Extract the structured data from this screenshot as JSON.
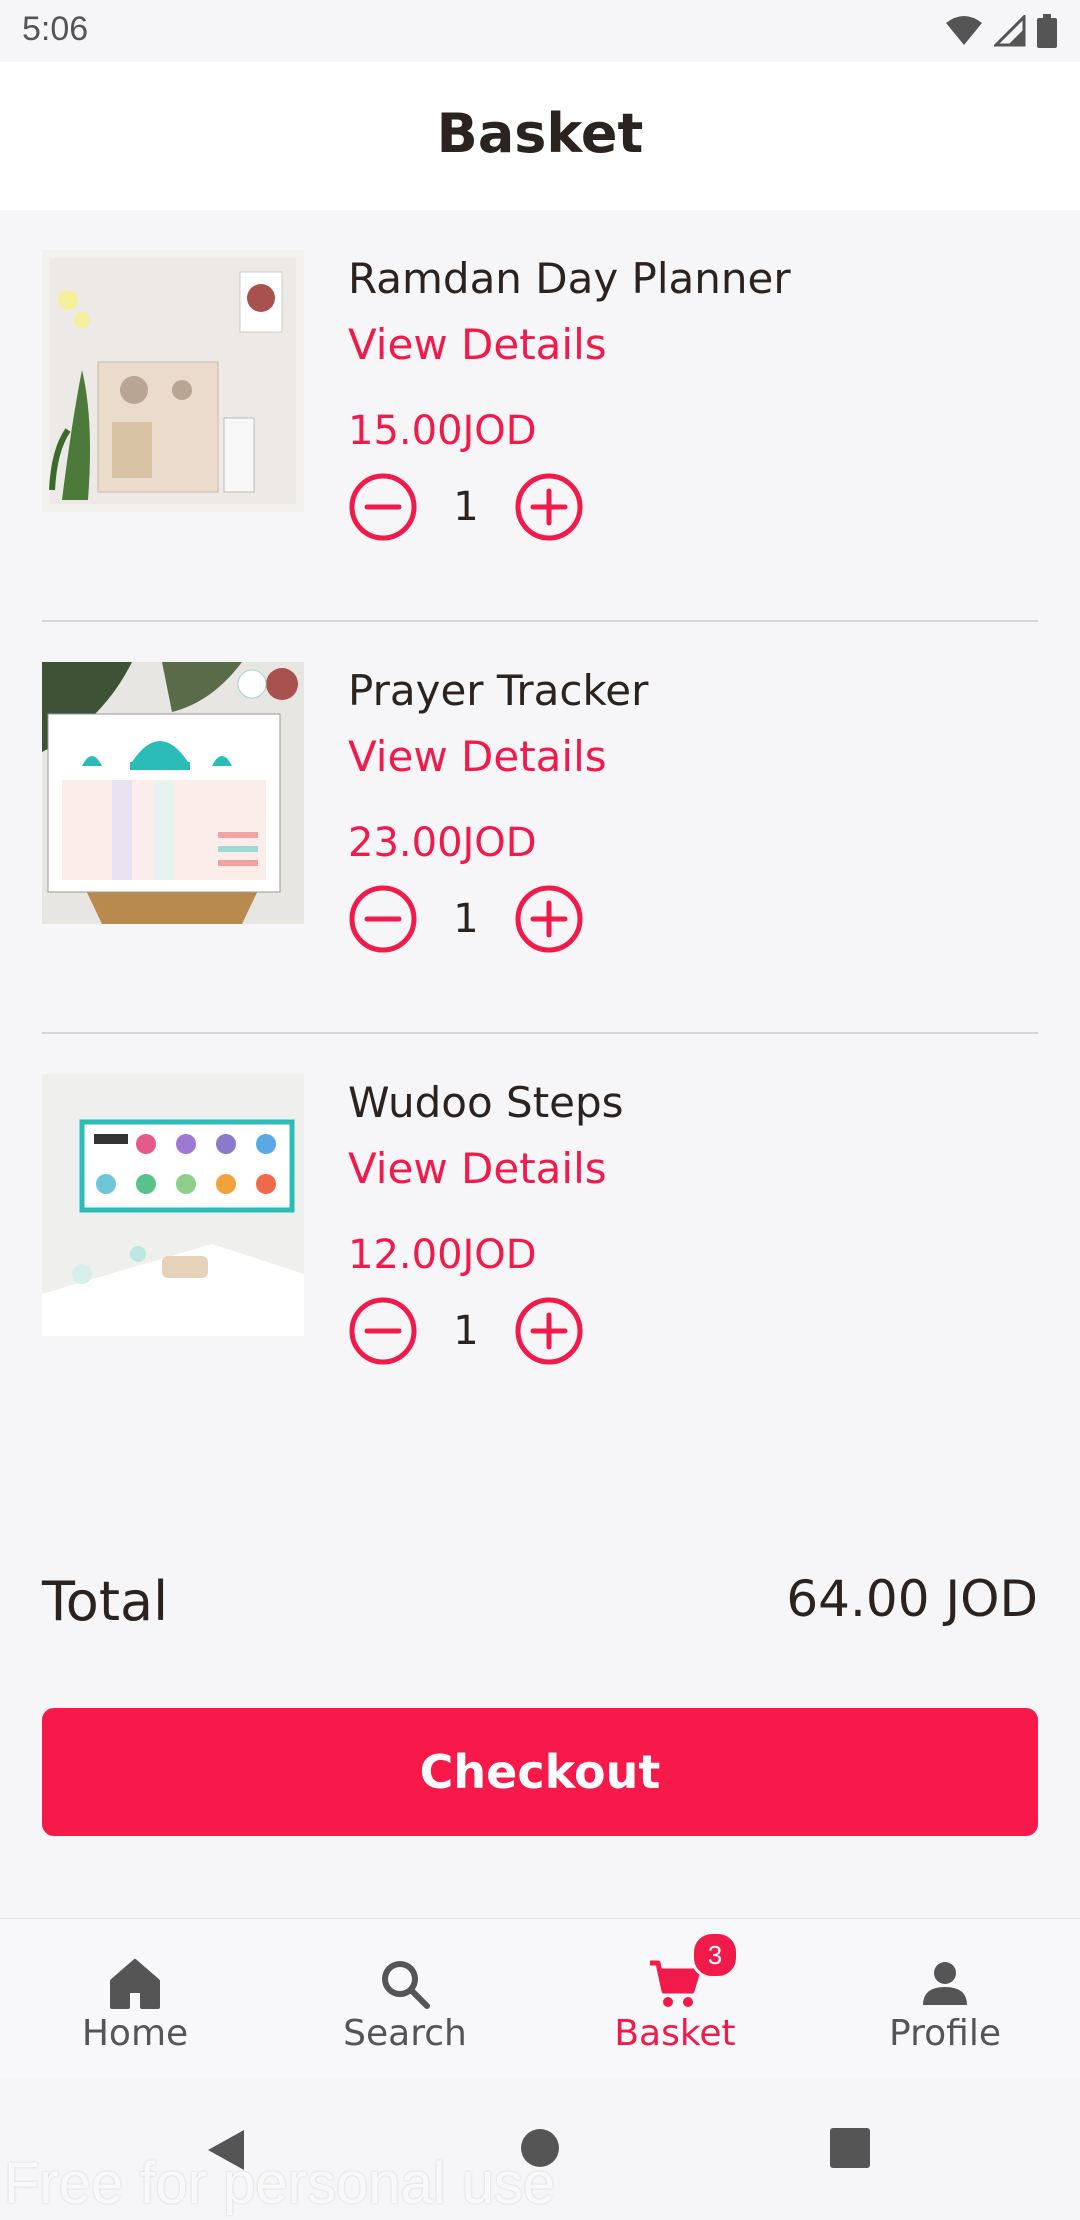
{
  "status_bar": {
    "time": "5:06"
  },
  "header": {
    "title": "Basket"
  },
  "items": [
    {
      "name": "Ramdan Day Planner",
      "details_label": "View Details",
      "price": "15.00JOD",
      "quantity": "1"
    },
    {
      "name": "Prayer Tracker",
      "details_label": "View Details",
      "price": "23.00JOD",
      "quantity": "1"
    },
    {
      "name": "Wudoo Steps",
      "details_label": "View Details",
      "price": "12.00JOD",
      "quantity": "1"
    }
  ],
  "summary": {
    "total_label": "Total",
    "total_value": "64.00 JOD",
    "checkout_label": "Checkout"
  },
  "bottom_nav": {
    "items": [
      {
        "label": "Home",
        "icon": "home-icon",
        "active": false
      },
      {
        "label": "Search",
        "icon": "search-icon",
        "active": false
      },
      {
        "label": "Basket",
        "icon": "cart-icon",
        "active": true,
        "badge": "3"
      },
      {
        "label": "Profile",
        "icon": "person-icon",
        "active": false
      }
    ]
  },
  "colors": {
    "accent": "#f11a4b",
    "text": "#2b2320",
    "background": "#f6f5f7"
  },
  "watermark": "Free for personal use"
}
